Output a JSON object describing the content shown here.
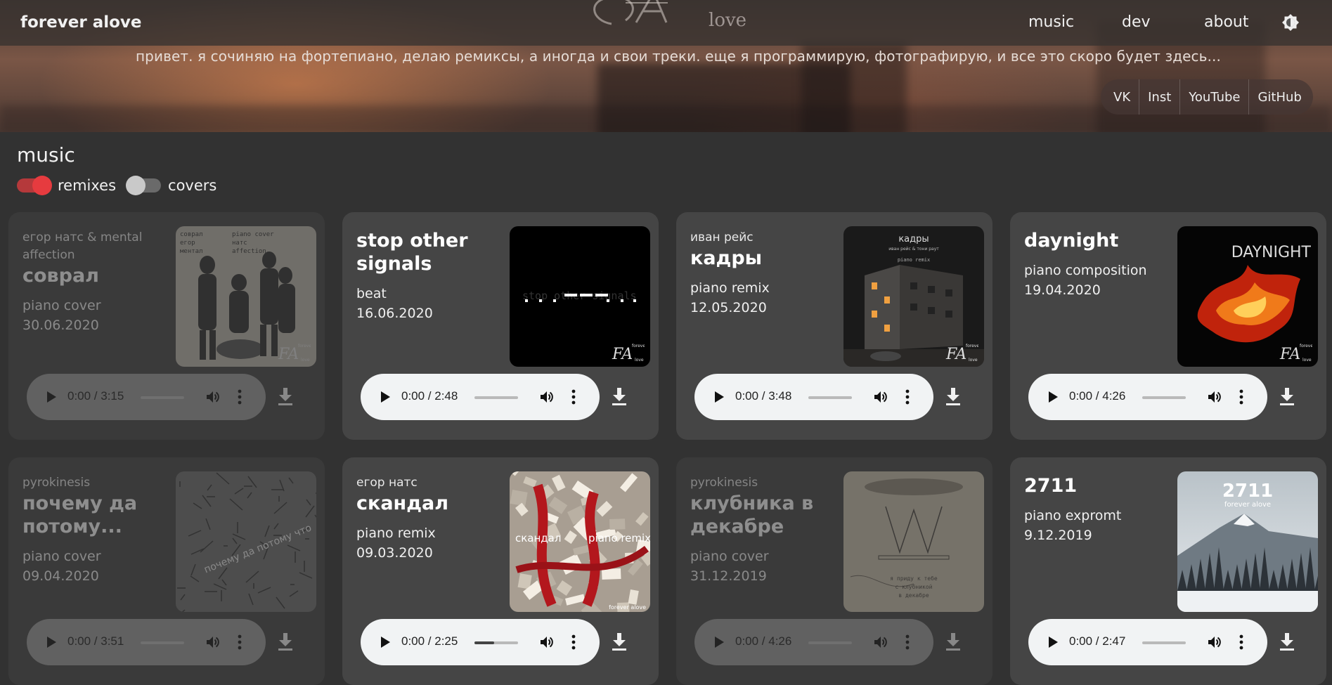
{
  "header": {
    "brand": "forever alove",
    "logo_text": "love",
    "nav": [
      "music",
      "dev",
      "about"
    ],
    "theme_icon": "brightness-icon"
  },
  "intro": "привет. я сочиняю на фортепиано, делаю ремиксы, а иногда и свои треки. еще я программирую, фотографирую, и все это скоро будет здесь...",
  "socials": [
    "VK",
    "Inst",
    "YouTube",
    "GitHub"
  ],
  "section": {
    "title": "music",
    "filters": [
      {
        "label": "remixes",
        "on": true
      },
      {
        "label": "covers",
        "on": false
      }
    ]
  },
  "tracks": [
    {
      "artist": "егор натс & mental affection",
      "title": "соврал",
      "type": "piano cover",
      "date": "30.06.2020",
      "time": "0:00 / 3:15",
      "progress": 0,
      "dimmed": true,
      "cover": "cover-sovral"
    },
    {
      "artist": "",
      "title": "stop other signals",
      "type": "beat",
      "date": "16.06.2020",
      "time": "0:00 / 2:48",
      "progress": 0,
      "dimmed": false,
      "cover": "cover-signals"
    },
    {
      "artist": "иван рейс",
      "title": "кадры",
      "type": "piano remix",
      "date": "12.05.2020",
      "time": "0:00 / 3:48",
      "progress": 0,
      "dimmed": false,
      "cover": "cover-kadry"
    },
    {
      "artist": "",
      "title": "daynight",
      "type": "piano composition",
      "date": "19.04.2020",
      "time": "0:00 / 4:26",
      "progress": 0,
      "dimmed": false,
      "cover": "cover-daynight"
    },
    {
      "artist": "pyrokinesis",
      "title": "почему да потому...",
      "type": "piano cover",
      "date": "09.04.2020",
      "time": "0:00 / 3:51",
      "progress": 0,
      "dimmed": true,
      "cover": "cover-pochemu"
    },
    {
      "artist": "егор натс",
      "title": "скандал",
      "type": "piano remix",
      "date": "09.03.2020",
      "time": "0:00 / 2:25",
      "progress": 0.45,
      "dimmed": false,
      "cover": "cover-skandal"
    },
    {
      "artist": "pyrokinesis",
      "title": "клубника в декабре",
      "type": "piano cover",
      "date": "31.12.2019",
      "time": "0:00 / 4:26",
      "progress": 0,
      "dimmed": true,
      "cover": "cover-klubnika"
    },
    {
      "artist": "",
      "title": "2711",
      "type": "piano expromt",
      "date": "9.12.2019",
      "time": "0:00 / 2:47",
      "progress": 0,
      "dimmed": false,
      "cover": "cover-2711"
    }
  ],
  "cover_text": {
    "sovral": [
      "соврал",
      "егор",
      "ментал",
      "piano cover",
      "натс",
      "affection"
    ],
    "signals": "stop other signals",
    "kadry_title": "кадры",
    "kadry_sub": "иван рейс & тони раут",
    "kadry_tag": "piano remix",
    "daynight": "DAYNIGHT",
    "pochemu": "почему да потому что",
    "skandal_left": "скандал",
    "skandal_right": "piano remix",
    "skandal_tag": "forever alove",
    "klubnika": [
      "я приду к тебе",
      "с клубникой",
      "в декабре"
    ],
    "t2711_title": "2711",
    "t2711_sub": "forever alove",
    "fa_mark": "FA",
    "fa_small": "forever",
    "fa_love": "love"
  }
}
